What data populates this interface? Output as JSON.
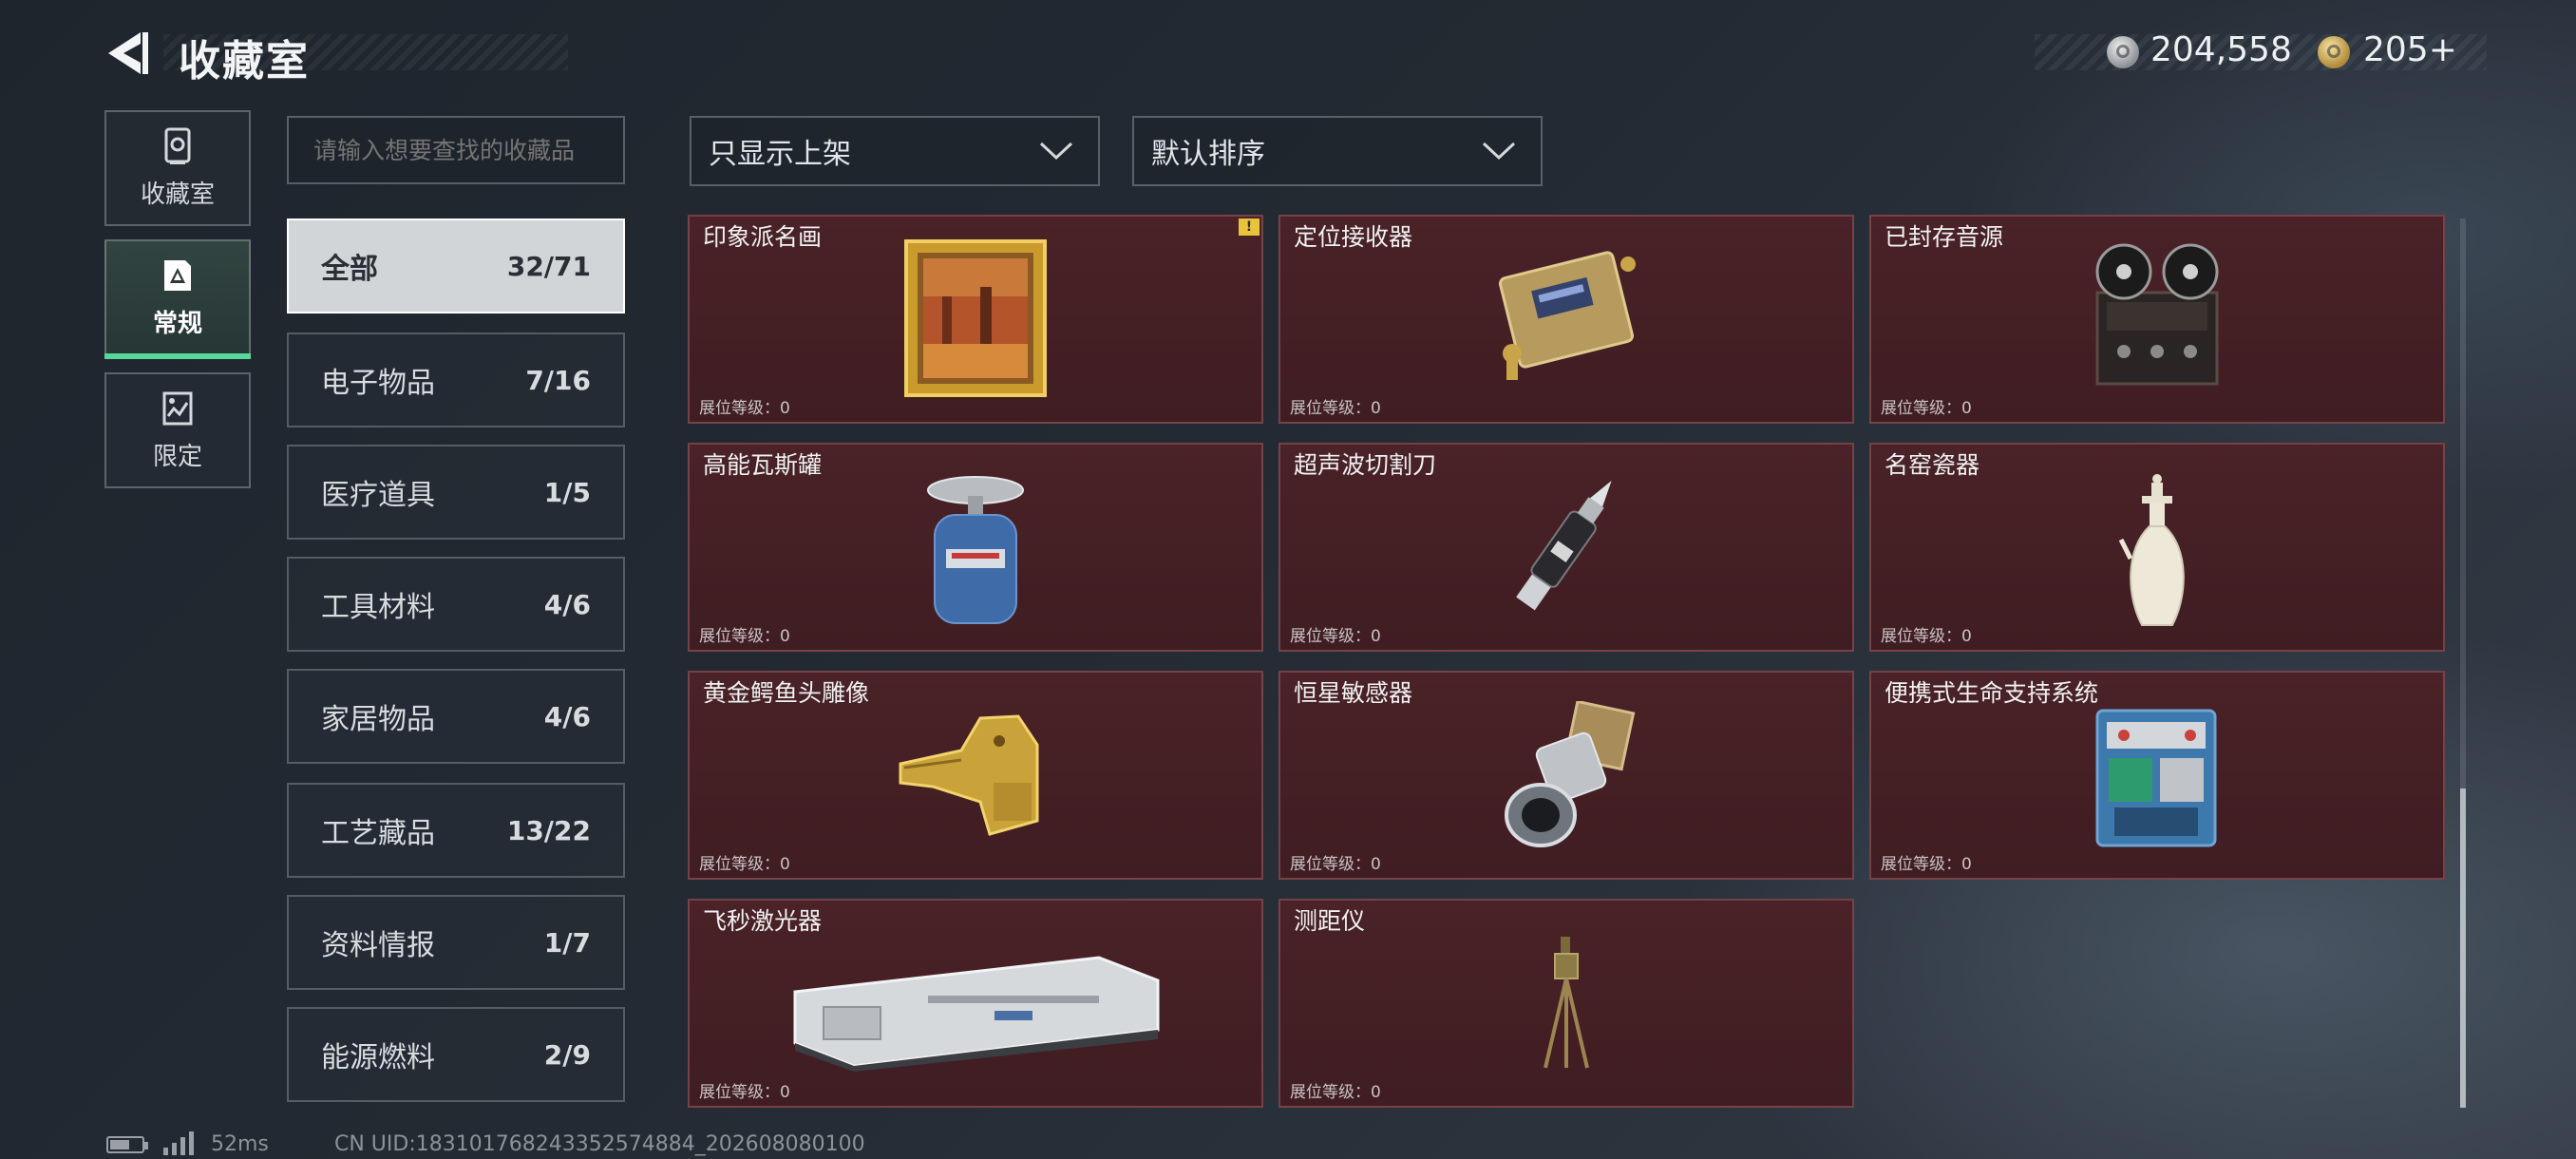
{
  "header": {
    "title": "收藏室",
    "currency_silver": "204,558",
    "currency_gold": "205+"
  },
  "nav": {
    "items": [
      {
        "label": "收藏室",
        "icon": "collection-room-icon"
      },
      {
        "label": "常规",
        "icon": "regular-icon",
        "active": true
      },
      {
        "label": "限定",
        "icon": "limited-icon"
      }
    ]
  },
  "search": {
    "placeholder": "请输入想要查找的收藏品"
  },
  "categories": [
    {
      "name": "全部",
      "count": "32/71",
      "active": true
    },
    {
      "name": "电子物品",
      "count": "7/16"
    },
    {
      "name": "医疗道具",
      "count": "1/5"
    },
    {
      "name": "工具材料",
      "count": "4/6"
    },
    {
      "name": "家居物品",
      "count": "4/6"
    },
    {
      "name": "工艺藏品",
      "count": "13/22"
    },
    {
      "name": "资料情报",
      "count": "1/7"
    },
    {
      "name": "能源燃料",
      "count": "2/9"
    }
  ],
  "filters": {
    "display": "只显示上架",
    "sort": "默认排序"
  },
  "items": [
    {
      "name": "印象派名画",
      "level": "展位等级：0",
      "icon": "framed-painting-icon",
      "warning": "!"
    },
    {
      "name": "定位接收器",
      "level": "展位等级：0",
      "icon": "gps-receiver-icon"
    },
    {
      "name": "已封存音源",
      "level": "展位等级：0",
      "icon": "reel-tape-recorder-icon"
    },
    {
      "name": "高能瓦斯罐",
      "level": "展位等级：0",
      "icon": "gas-canister-icon"
    },
    {
      "name": "超声波切割刀",
      "level": "展位等级：0",
      "icon": "ultrasonic-cutter-icon"
    },
    {
      "name": "名窑瓷器",
      "level": "展位等级：0",
      "icon": "porcelain-vase-icon"
    },
    {
      "name": "黄金鳄鱼头雕像",
      "level": "展位等级：0",
      "icon": "golden-crocodile-statue-icon"
    },
    {
      "name": "恒星敏感器",
      "level": "展位等级：0",
      "icon": "star-sensor-icon"
    },
    {
      "name": "便携式生命支持系统",
      "level": "展位等级：0",
      "icon": "life-support-system-icon"
    },
    {
      "name": "飞秒激光器",
      "level": "展位等级：0",
      "icon": "femtosecond-laser-icon"
    },
    {
      "name": "测距仪",
      "level": "展位等级：0",
      "icon": "rangefinder-icon"
    }
  ],
  "footer": {
    "ping": "52ms",
    "uid": "CN UID:18310176824335257488​4_202608080100"
  }
}
